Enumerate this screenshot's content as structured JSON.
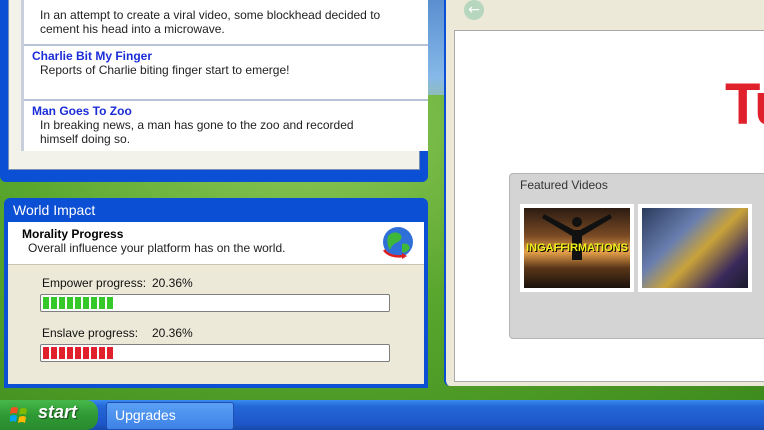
{
  "news": {
    "items": [
      {
        "title": "",
        "description": "In an attempt to create a viral video, some blockhead decided to cement his head into a microwave."
      },
      {
        "title": "Charlie Bit My Finger",
        "description": "Reports of Charlie biting finger start to emerge!"
      },
      {
        "title": "Man Goes To Zoo",
        "description": "In breaking news, a man has gone to the zoo and recorded himself doing so."
      }
    ]
  },
  "world_impact": {
    "window_title": "World Impact",
    "heading": "Morality Progress",
    "subheading": "Overall influence your platform has on the world.",
    "icon": "globe-icon",
    "empower": {
      "label": "Empower progress:",
      "percent_text": "20.36%",
      "value": 0.2036,
      "color": "#35c82a"
    },
    "enslave": {
      "label": "Enslave progress:",
      "percent_text": "20.36%",
      "value": 0.2036,
      "color": "#e0202a"
    }
  },
  "browser": {
    "back_icon": "back-arrow-icon",
    "logo_text": "Tu",
    "featured": {
      "title": "Featured Videos",
      "videos": [
        {
          "thumb_text": "INGAFFIRMATIONS"
        },
        {
          "thumb_text": ""
        }
      ]
    }
  },
  "taskbar": {
    "start_label": "start",
    "tasks": [
      {
        "label": "Upgrades"
      }
    ]
  }
}
